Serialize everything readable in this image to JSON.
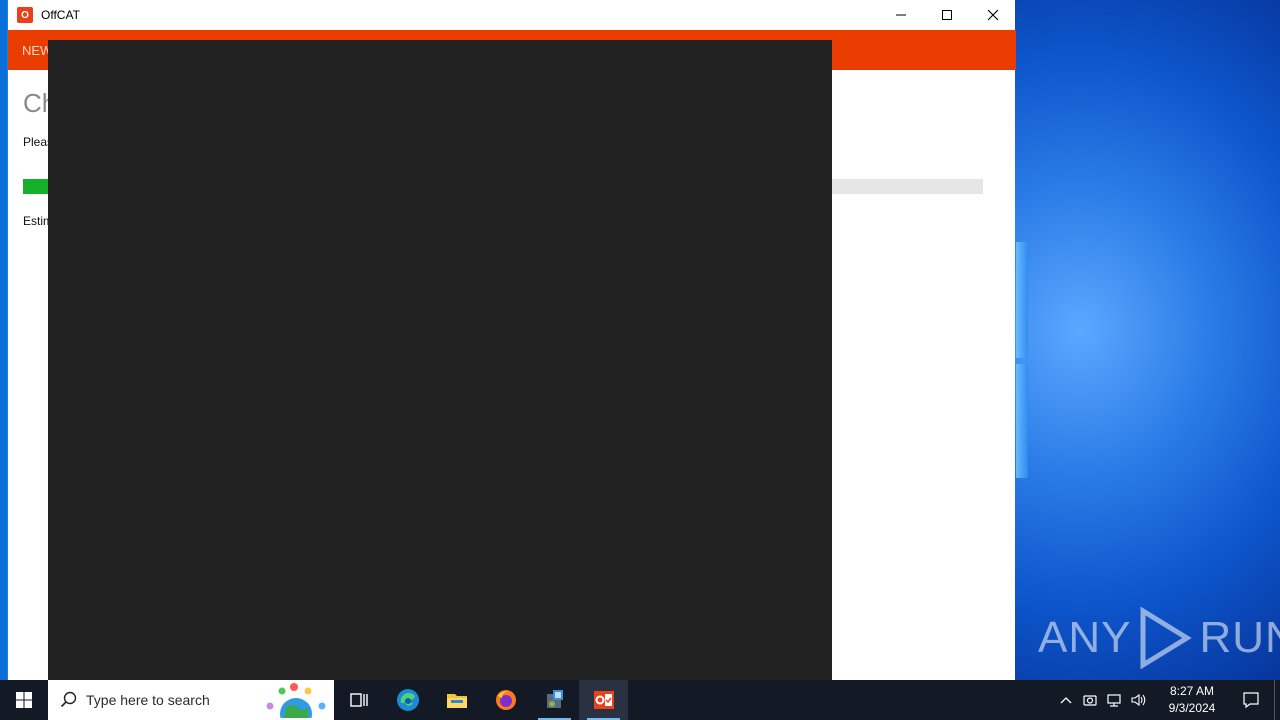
{
  "window": {
    "title": "OffCAT",
    "title_icon": "O"
  },
  "app": {
    "nav_label": "NEW",
    "heading": "Ch",
    "description": "Pleas",
    "progress_fraction": 0.03,
    "estimate": "Estim"
  },
  "taskbar": {
    "search_placeholder": "Type here to search",
    "time": "8:27 AM",
    "date": "9/3/2024",
    "active_app": "OffCAT"
  },
  "watermark": {
    "text_left": "ANY",
    "text_right": "RUN"
  },
  "colors": {
    "accent_header": "#eb3c00",
    "progress": "#14b02a",
    "overlay": "#212121",
    "taskbar": "#131a26"
  }
}
